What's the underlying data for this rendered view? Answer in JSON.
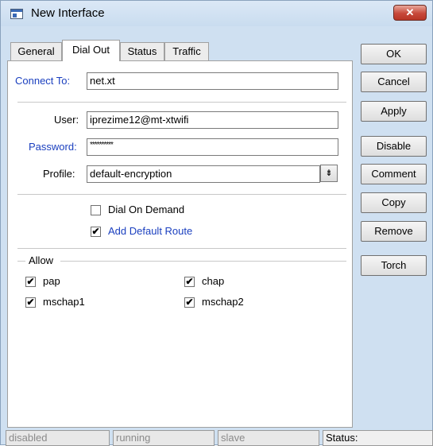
{
  "window": {
    "title": "New Interface",
    "close_glyph": "✕"
  },
  "tabs": [
    {
      "label": "General"
    },
    {
      "label": "Dial Out"
    },
    {
      "label": "Status"
    },
    {
      "label": "Traffic"
    }
  ],
  "form": {
    "connect_to": {
      "label": "Connect To:",
      "value": "net.xt"
    },
    "user": {
      "label": "User:",
      "value": "iprezime12@mt-xtwifi"
    },
    "password": {
      "label": "Password:",
      "value": "**********"
    },
    "profile": {
      "label": "Profile:",
      "value": "default-encryption",
      "dropdown_glyph": "⇟"
    },
    "dial_on_demand": {
      "label": "Dial On Demand",
      "checked": false
    },
    "add_default_route": {
      "label": "Add Default Route",
      "checked": true
    }
  },
  "allow": {
    "legend": "Allow",
    "items": [
      {
        "label": "pap",
        "checked": true
      },
      {
        "label": "chap",
        "checked": true
      },
      {
        "label": "mschap1",
        "checked": true
      },
      {
        "label": "mschap2",
        "checked": true
      }
    ]
  },
  "check_glyph": "✔",
  "buttons": {
    "ok": "OK",
    "cancel": "Cancel",
    "apply": "Apply",
    "disable": "Disable",
    "comment": "Comment",
    "copy": "Copy",
    "remove": "Remove",
    "torch": "Torch"
  },
  "statusbar": {
    "disabled": "disabled",
    "running": "running",
    "slave": "slave",
    "status": "Status:"
  },
  "colors": {
    "window_bg": "#cfe0f1",
    "label_accent": "#1a3fbf",
    "close_button": "#c7483a"
  }
}
